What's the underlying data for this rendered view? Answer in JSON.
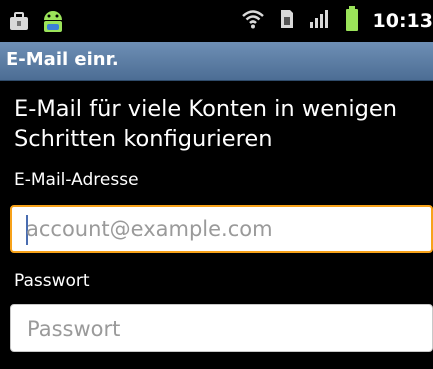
{
  "statusbar": {
    "time": "10:13",
    "icons": [
      "briefcase-icon",
      "android-icon",
      "wifi-icon",
      "sim-icon",
      "signal-icon",
      "battery-icon"
    ]
  },
  "titlebar": {
    "title": "E-Mail einr."
  },
  "heading": "E-Mail für viele Konten in wenigen Schritten konfigurieren",
  "email": {
    "label": "E-Mail-Adresse",
    "placeholder": "account@example.com"
  },
  "password": {
    "label": "Passwort",
    "placeholder": "Passwort"
  },
  "colors": {
    "titlebar": "#5a7ca3",
    "focus_border": "#f7a21a",
    "battery": "#9be35a"
  }
}
